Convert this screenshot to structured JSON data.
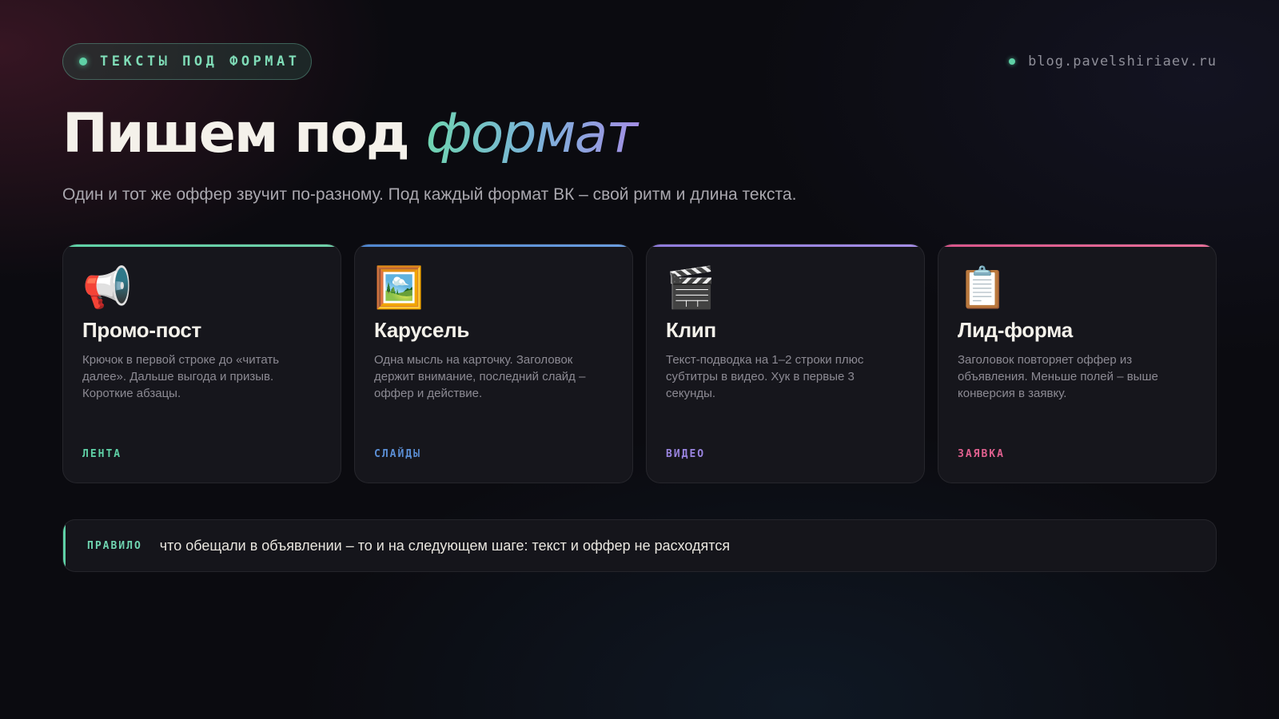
{
  "header": {
    "badge": "ТЕКСТЫ ПОД ФОРМАТ",
    "site": "blog.pavelshiriaev.ru"
  },
  "title": {
    "main": "Пишем под ",
    "accent": "формат"
  },
  "subtitle": "Один и тот же оффер звучит по-разному. Под каждый формат ВК – свой ритм и длина текста.",
  "cards": [
    {
      "icon": "megaphone-icon",
      "emoji": "📢",
      "title": "Промо-пост",
      "description": "Крючок в первой строке до «читать далее». Дальше выгода и призыв. Короткие абзацы.",
      "tag": "ЛЕНТА",
      "color": "#5fd1a6"
    },
    {
      "icon": "framed-picture-icon",
      "emoji": "🖼️",
      "title": "Карусель",
      "description": "Одна мысль на карточку. Заголовок держит внимание, последний слайд – оффер и действие.",
      "tag": "СЛАЙДЫ",
      "color": "#5b8fd6"
    },
    {
      "icon": "clapper-board-icon",
      "emoji": "🎬",
      "title": "Клип",
      "description": "Текст-подводка на 1–2 строки плюс субтитры в видео. Хук в первые 3 секунды.",
      "tag": "ВИДЕО",
      "color": "#9a84e0"
    },
    {
      "icon": "clipboard-icon",
      "emoji": "📋",
      "title": "Лид-форма",
      "description": "Заголовок повторяет оффер из объявления. Меньше полей – выше конверсия в заявку.",
      "tag": "ЗАЯВКА",
      "color": "#e0608f"
    }
  ],
  "rule": {
    "label": "ПРАВИЛО",
    "text": "что обещали в объявлении – то и на следующем шаге: текст и оффер не расходятся",
    "color": "#5fd1a6"
  }
}
